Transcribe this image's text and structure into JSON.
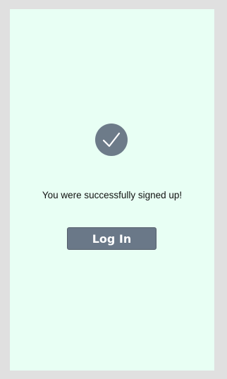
{
  "signup_success": {
    "message": "You were successfully signed up!",
    "icon": "checkmark-icon",
    "login_button_label": "Log In"
  },
  "colors": {
    "page_background": "#e8fff4",
    "outer_background": "#e0e0e0",
    "accent": "#6a7888"
  }
}
